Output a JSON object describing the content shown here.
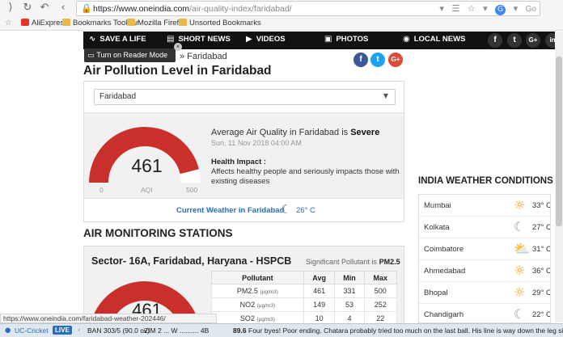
{
  "browser": {
    "url_host": "https://www.oneindia.com",
    "url_path": "/air-quality-index/faridabad/",
    "search_label": "Go",
    "bookmarks": [
      "AliExpress",
      "Bookmarks Toolbar",
      "Mozilla Firefox",
      "Unsorted Bookmarks"
    ]
  },
  "nav": {
    "items": [
      "SAVE A LIFE",
      "SHORT NEWS",
      "VIDEOS",
      "PHOTOS",
      "LOCAL NEWS"
    ],
    "social": [
      "f",
      "t",
      "G+",
      "in"
    ]
  },
  "reader_tip": "Turn on Reader Mode",
  "breadcrumb": "» Faridabad",
  "share": [
    "f",
    "t",
    "G+"
  ],
  "title": "Air Pollution Level in Faridabad",
  "city_select": "Faridabad",
  "aqi": {
    "value": "461",
    "min_label": "0",
    "unit_label": "AQI",
    "max_label": "500",
    "level": 0.922,
    "avg_prefix": "Average Air Quality in Faridabad is ",
    "avg_status": "Severe",
    "date": "Sun, 11 Nov 2018 04:00 AM",
    "health_title": "Health Impact :",
    "health_text": "Affects healthy people and seriously impacts those with existing diseases",
    "current_weather": "Current Weather in Faridabad",
    "weather_temp": "26° C",
    "gauge_color": "#c9302c"
  },
  "stations_title": "AIR MONITORING STATIONS",
  "station": {
    "name": "Sector- 16A, Faridabad, Haryana - HSPCB",
    "sig_label": "Significant Pollutant is ",
    "sig_value": "PM2.5",
    "value": "461",
    "level": 0.922,
    "headers": [
      "Pollutant",
      "Avg",
      "Min",
      "Max"
    ],
    "rows": [
      {
        "name": "PM2.5",
        "unit": "(µg/m3)",
        "avg": "461",
        "min": "331",
        "max": "500"
      },
      {
        "name": "NO2",
        "unit": "(µg/m3)",
        "avg": "149",
        "min": "53",
        "max": "252"
      },
      {
        "name": "SO2",
        "unit": "(µg/m3)",
        "avg": "10",
        "min": "4",
        "max": "22"
      }
    ]
  },
  "weather": {
    "title": "INDIA WEATHER CONDITIONS",
    "cities": [
      {
        "city": "Mumbai",
        "temp": "33° C",
        "icon": "sun-icon"
      },
      {
        "city": "Kolkata",
        "temp": "27° C",
        "icon": "moon-icon"
      },
      {
        "city": "Coimbatore",
        "temp": "31° C",
        "icon": "partly-cloudy-icon"
      },
      {
        "city": "Ahmedabad",
        "temp": "36° C",
        "icon": "sun-icon"
      },
      {
        "city": "Bhopal",
        "temp": "29° C",
        "icon": "sun-icon"
      },
      {
        "city": "Chandigarh",
        "temp": "22° C",
        "icon": "moon-icon"
      }
    ]
  },
  "status_url": "https://www.oneindia.com/faridabad-weather-202446/",
  "ticker": {
    "app": "UC-Cricket",
    "live": "LIVE",
    "score1": "BAN 303/5 (90.0 ov)",
    "score2": "ZIM 2 ... W .......... 4B",
    "num": "89.6",
    "commentary": "Four byes! Poor ending. Chatara probably tried too much on the last ball. His line is way down the leg side, Rahim fails to"
  }
}
